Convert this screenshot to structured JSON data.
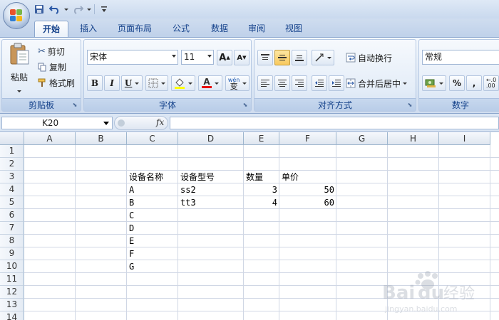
{
  "qat": {
    "icons": [
      "save-icon",
      "undo-icon",
      "redo-icon",
      "customize-icon"
    ]
  },
  "tabs": [
    {
      "label": "开始",
      "active": true
    },
    {
      "label": "插入"
    },
    {
      "label": "页面布局"
    },
    {
      "label": "公式"
    },
    {
      "label": "数据"
    },
    {
      "label": "审阅"
    },
    {
      "label": "视图"
    }
  ],
  "ribbon": {
    "clipboard": {
      "label": "剪贴板",
      "paste": "粘贴",
      "cut": "剪切",
      "copy": "复制",
      "format_painter": "格式刷"
    },
    "font": {
      "label": "字体",
      "font_name": "宋体",
      "font_size": "11",
      "bold": "B",
      "italic": "I",
      "underline": "U",
      "font_color_glyph": "A",
      "grow": "A",
      "shrink": "A",
      "phonetic": "wén 变"
    },
    "alignment": {
      "label": "对齐方式",
      "wrap_text": "自动换行",
      "merge_center": "合并后居中"
    },
    "number": {
      "label": "数字",
      "format": "常规",
      "percent": "%",
      "comma": ","
    }
  },
  "formula_bar": {
    "name_box": "K20",
    "fx": "fx",
    "formula": ""
  },
  "grid": {
    "columns": [
      "A",
      "B",
      "C",
      "D",
      "E",
      "F",
      "G",
      "H",
      "I"
    ],
    "rows": [
      "1",
      "2",
      "3",
      "4",
      "5",
      "6",
      "7",
      "8",
      "9",
      "10",
      "11",
      "12",
      "13",
      "14"
    ],
    "cells": {
      "C3": "设备名称",
      "D3": "设备型号",
      "E3": "数量",
      "F3": "单价",
      "C4": "A",
      "D4": "ss2",
      "E4": "3",
      "F4": "50",
      "C5": "B",
      "D5": "tt3",
      "E5": "4",
      "F5": "60",
      "C6": "C",
      "C7": "D",
      "C8": "E",
      "C9": "F",
      "C10": "G"
    }
  },
  "colors": {
    "tab_text": "#15428b",
    "grid_line": "#d0d7e5",
    "header_border": "#9eb6ce"
  }
}
